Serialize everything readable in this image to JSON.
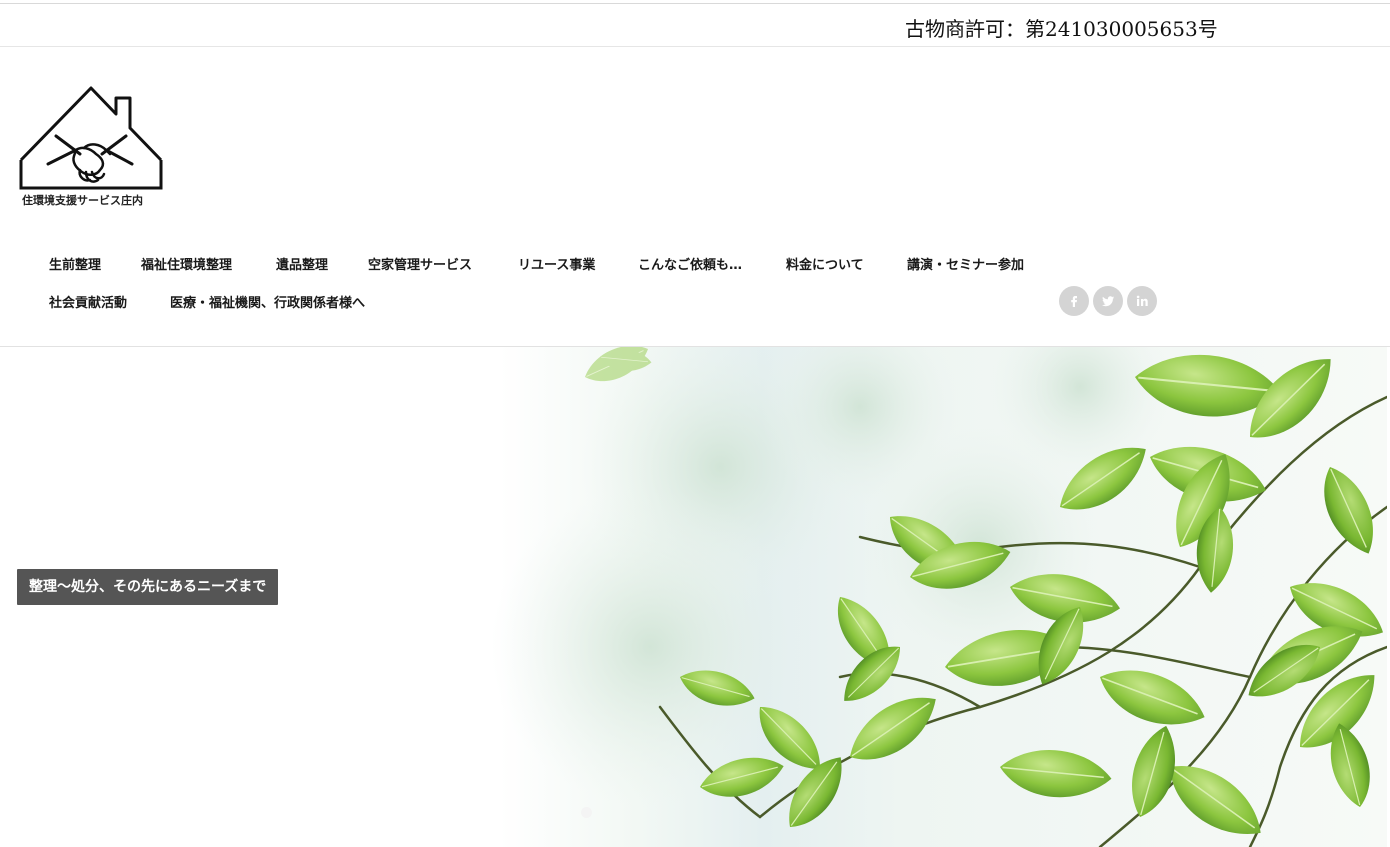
{
  "topbar": {
    "license": "古物商許可：第241030005653号"
  },
  "logo": {
    "text": "住環境支援サービス庄内",
    "icon": "house-handshake-icon"
  },
  "nav": {
    "row1": [
      "生前整理",
      "福祉住環境整理",
      "遺品整理",
      "空家管理サービス",
      "リユース事業",
      "こんなご依頼も…",
      "料金について",
      "講演・セミナー参加"
    ],
    "row2": [
      "社会貢献活動",
      "医療・福祉機関、行政関係者様へ"
    ]
  },
  "social": [
    {
      "name": "facebook",
      "icon": "facebook-icon",
      "glyph": "f"
    },
    {
      "name": "twitter",
      "icon": "twitter-icon"
    },
    {
      "name": "linkedin",
      "icon": "linkedin-icon",
      "glyph": "in"
    }
  ],
  "hero": {
    "caption": "整理〜処分、その先にあるニーズまで",
    "image": "green-leaves-photo",
    "slides_count": 1,
    "active_slide": 1
  },
  "colors": {
    "caption_bg": "#555555",
    "social_bg": "#d4d4d4",
    "leaf_green": "#8cc63f"
  }
}
